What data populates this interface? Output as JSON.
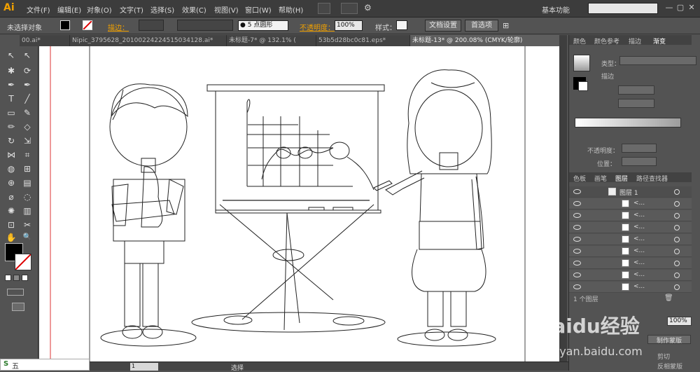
{
  "app": {
    "logo": "Ai",
    "menus": [
      "文件(F)",
      "编辑(E)",
      "对象(O)",
      "文字(T)",
      "选择(S)",
      "效果(C)",
      "视图(V)",
      "窗口(W)",
      "帮助(H)"
    ],
    "workspace": "基本功能",
    "window_buttons": [
      "—",
      "▢",
      "✕"
    ]
  },
  "control_bar": {
    "no_selection": "未选择对象",
    "stroke_label": "描边：",
    "brush_label": "5 点圆形",
    "opacity_label": "不透明度：",
    "opacity_value": "100%",
    "style_label": "样式：",
    "doc_settings": "文档设置",
    "preferences": "首选项"
  },
  "tabs": [
    {
      "label": "00.ai*",
      "active": false
    },
    {
      "label": "Nipic_3795628_20100224224515034128.ai*",
      "active": false
    },
    {
      "label": "未标题-7* @ 132.1% (",
      "active": false
    },
    {
      "label": "53b5d28bc0c81.eps*",
      "active": false
    },
    {
      "label": "未标题-13* @ 200.08% (CMYK/轮廓)",
      "active": true
    }
  ],
  "tools": {
    "icons": [
      "selection-icon",
      "direct-selection-icon",
      "magic-wand-icon",
      "lasso-icon",
      "pen-icon",
      "curvature-icon",
      "type-icon",
      "line-icon",
      "rectangle-icon",
      "paintbrush-icon",
      "pencil-icon",
      "eraser-icon",
      "rotate-icon",
      "scale-icon",
      "width-icon",
      "free-transform-icon",
      "shape-builder-icon",
      "perspective-icon",
      "mesh-icon",
      "gradient-icon",
      "eyedropper-icon",
      "blend-icon",
      "symbol-sprayer-icon",
      "column-graph-icon",
      "artboard-icon",
      "slice-icon",
      "hand-icon",
      "zoom-icon"
    ],
    "glyphs": [
      "↖",
      "↖",
      "✱",
      "⟳",
      "✒",
      "✒",
      "T",
      "╱",
      "▭",
      "✎",
      "✏",
      "◇",
      "↻",
      "⇲",
      "⋈",
      "⌗",
      "◍",
      "⊞",
      "⊕",
      "▤",
      "⌀",
      "◌",
      "✺",
      "▥",
      "⊡",
      "✂",
      "✋",
      "🔍"
    ]
  },
  "right_panel": {
    "top_tabs": [
      "颜色",
      "颜色参考",
      "描边",
      "渐变"
    ],
    "gradient": {
      "type_label": "类型：",
      "stroke_label": "描边",
      "opacity_label": "不透明度：",
      "position_label": "位置："
    },
    "layer_tabs": [
      "色板",
      "画笔",
      "图层",
      "路径查找器"
    ],
    "layer_name": "图层 1",
    "sublayers": [
      "<...",
      "<...",
      "<...",
      "<...",
      "<...",
      "<...",
      "<...",
      "<..."
    ],
    "layer_count": "1 个图层",
    "lower": {
      "opacity_value": "100%",
      "make_mask": "制作蒙版",
      "clip": "剪切",
      "invert_mask": "反相蒙版"
    }
  },
  "status_bar": {
    "zoom_value": "1",
    "tool_name": "选择"
  },
  "ime": {
    "label": "五"
  },
  "colors": {
    "fill": "#000000",
    "stroke": "#ffffff",
    "accent": "#f0a000"
  },
  "watermark": {
    "brand": "Baidu经验",
    "url": "jingyan.baidu.com"
  }
}
